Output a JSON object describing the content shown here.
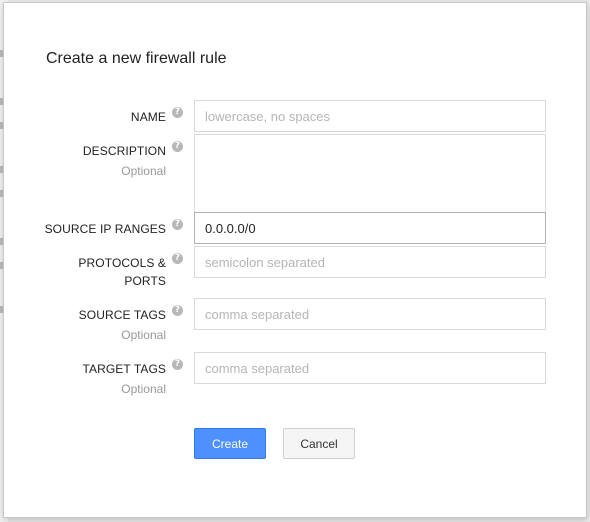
{
  "dialog": {
    "title": "Create a new firewall rule"
  },
  "form": {
    "name": {
      "label": "NAME",
      "placeholder": "lowercase, no spaces",
      "value": ""
    },
    "description": {
      "label": "DESCRIPTION",
      "optional": "Optional",
      "value": ""
    },
    "source_ip_ranges": {
      "label": "SOURCE IP RANGES",
      "value": "0.0.0.0/0"
    },
    "protocols_ports": {
      "label_line1": "PROTOCOLS &",
      "label_line2": "PORTS",
      "placeholder": "semicolon separated",
      "value": ""
    },
    "source_tags": {
      "label": "SOURCE TAGS",
      "optional": "Optional",
      "placeholder": "comma separated",
      "value": ""
    },
    "target_tags": {
      "label": "TARGET TAGS",
      "optional": "Optional",
      "placeholder": "comma separated",
      "value": ""
    }
  },
  "actions": {
    "create_label": "Create",
    "cancel_label": "Cancel"
  },
  "icons": {
    "help": "help-icon"
  },
  "colors": {
    "primary_button": "#4d90fe",
    "placeholder_text": "#b5b5b5",
    "optional_text": "#999999"
  }
}
